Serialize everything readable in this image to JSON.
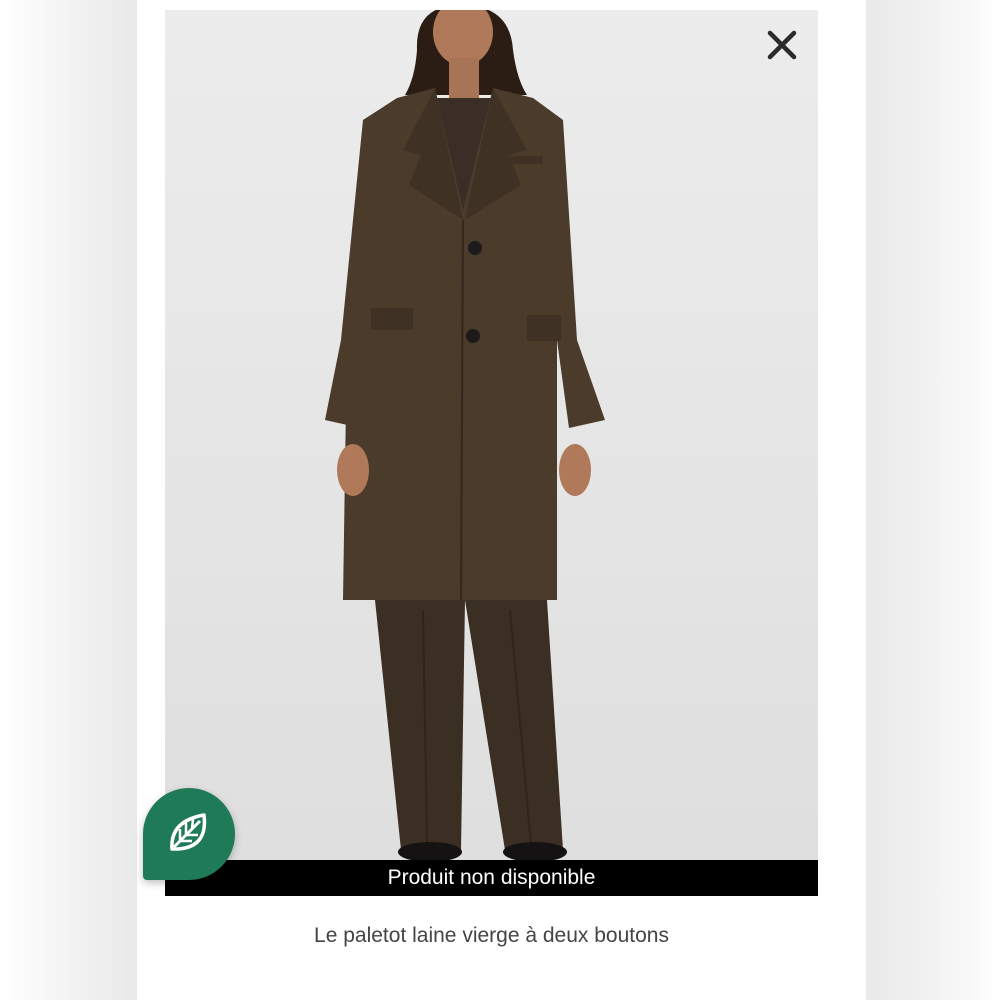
{
  "product": {
    "title": "Le paletot laine vierge à deux boutons",
    "availability_banner": "Produit non disponible",
    "image_description_alt": "",
    "colors": {
      "banner_bg": "#000000",
      "banner_text": "#ffffff",
      "eco_badge": "#1f7a58",
      "coat": "#4a3b2b",
      "pants": "#3b2e22"
    }
  },
  "controls": {
    "close_icon": "close-icon"
  },
  "badge": {
    "icon": "eco-leaf-icon"
  }
}
